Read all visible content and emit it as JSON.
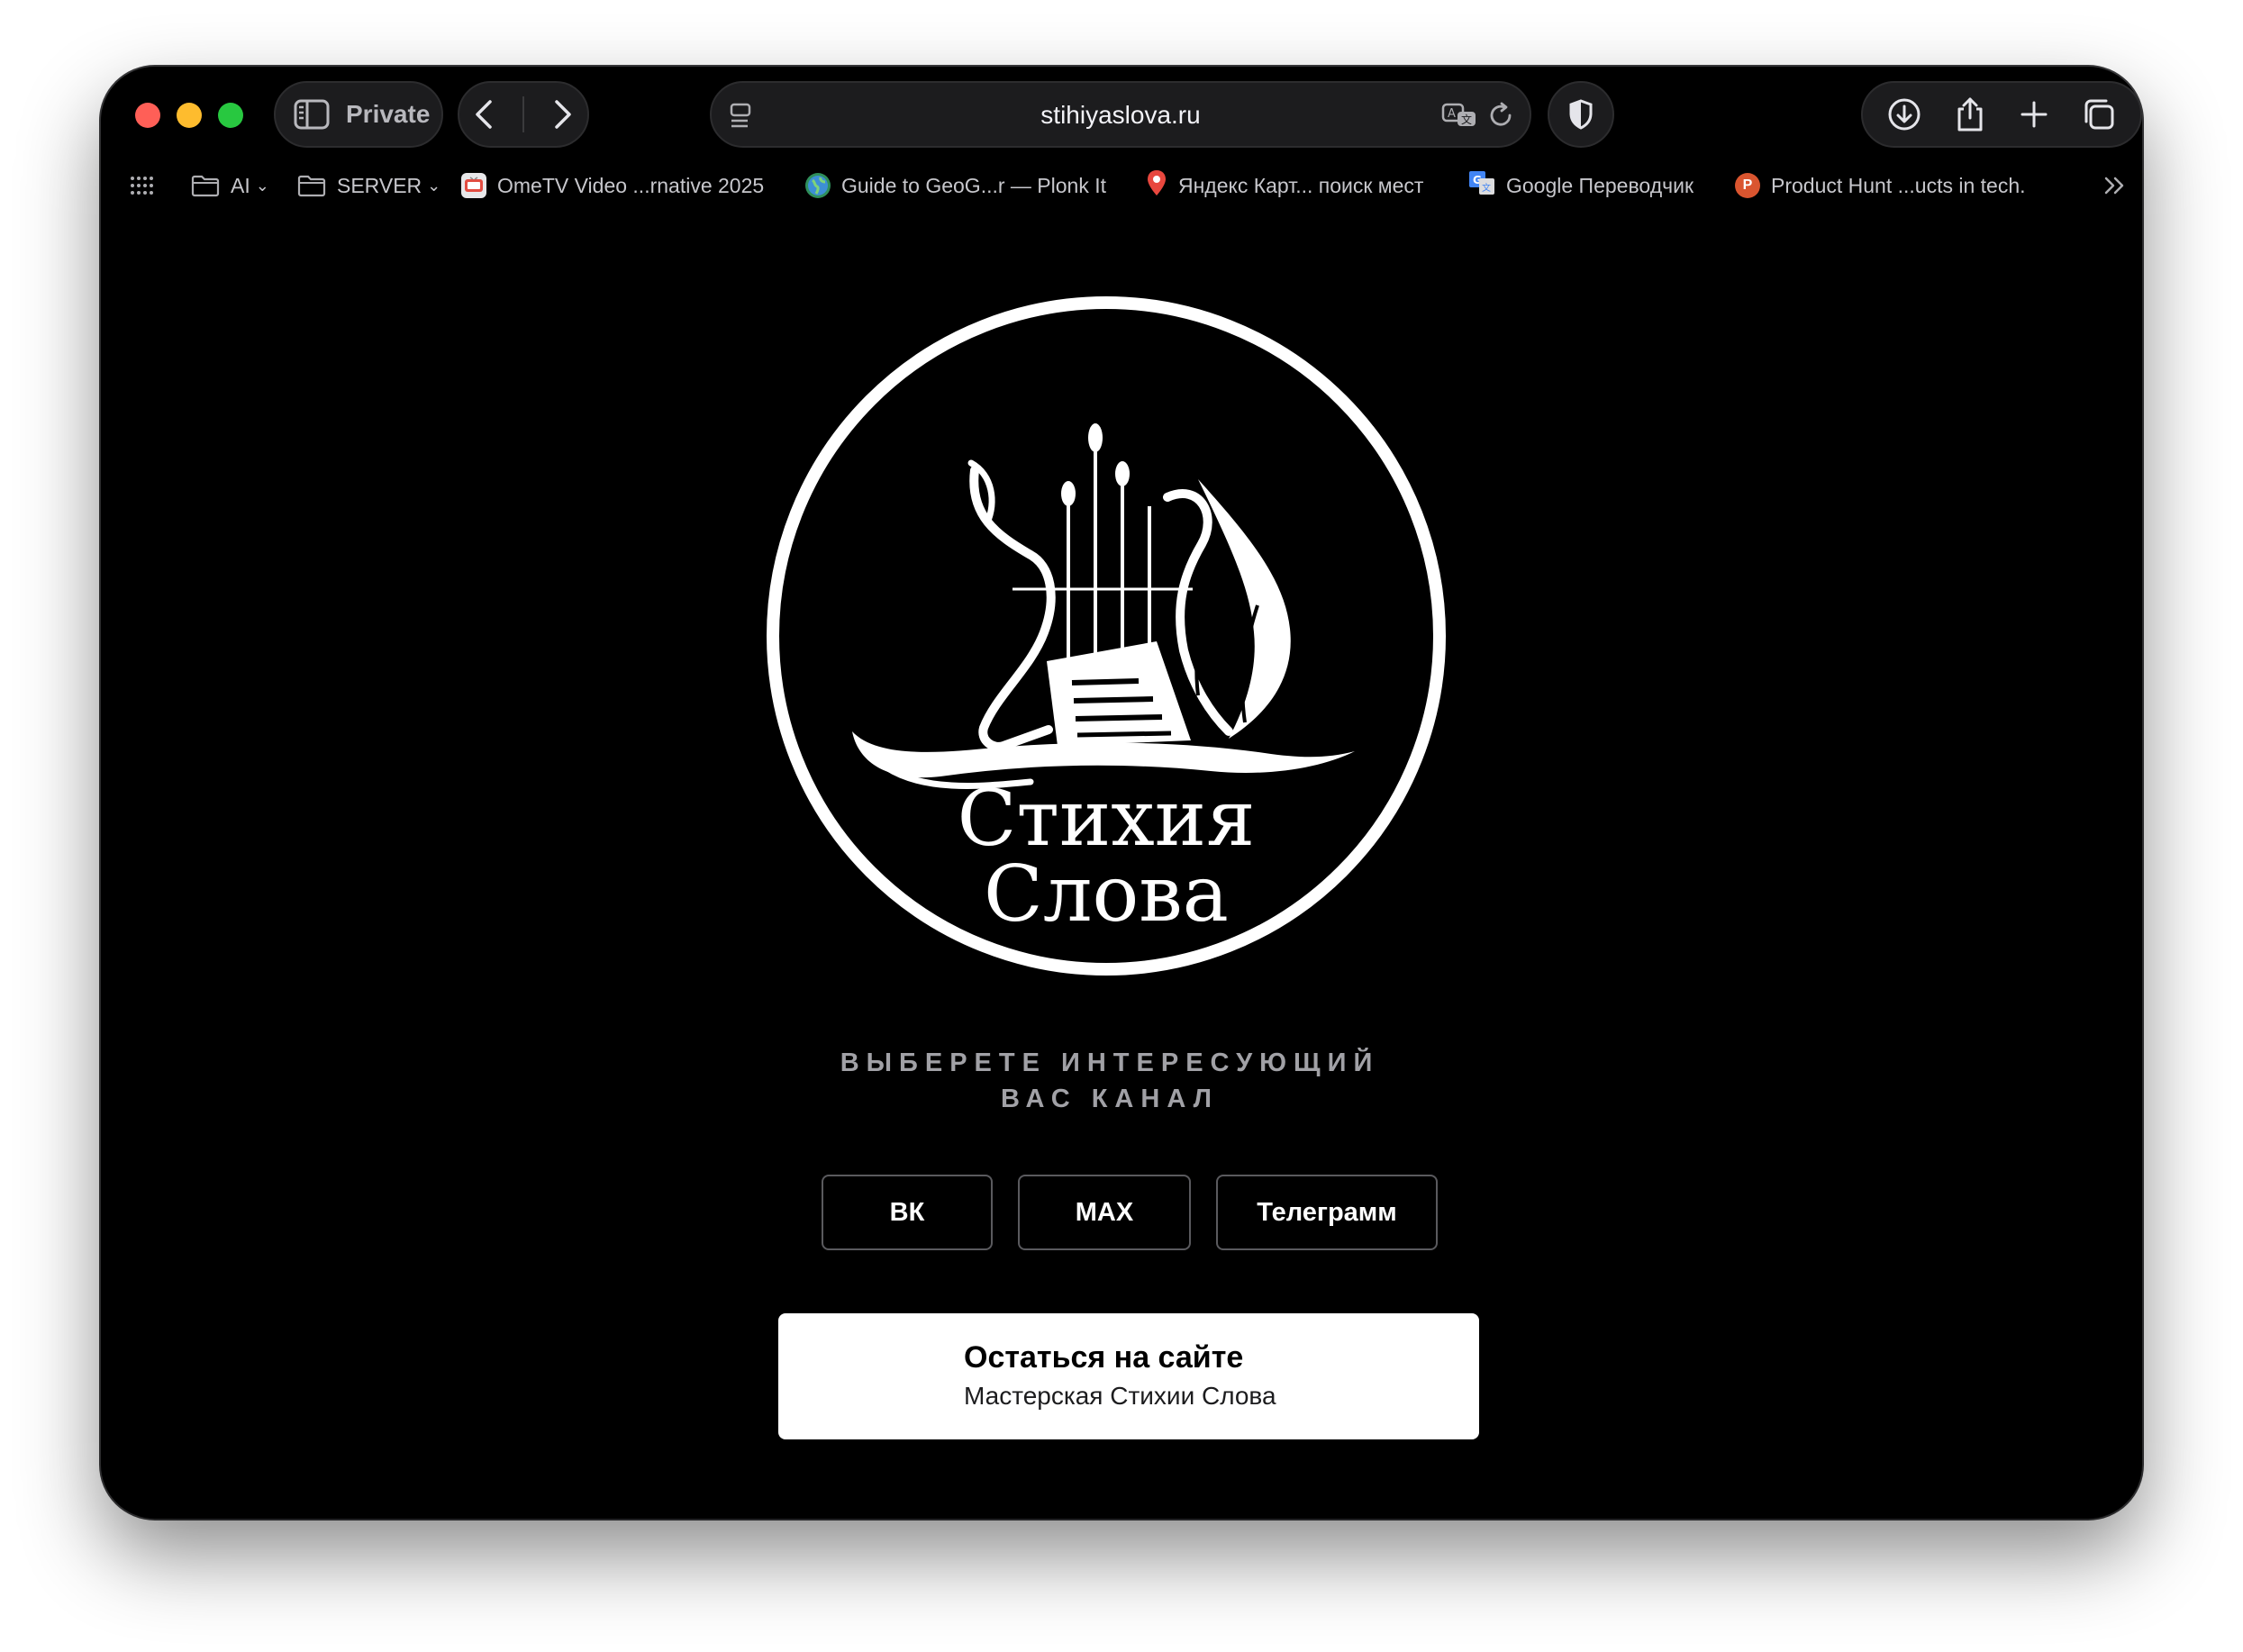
{
  "browser": {
    "private_label": "Private",
    "url": "stihiyaslova.ru"
  },
  "bookmarks": {
    "items": [
      {
        "label": "AI"
      },
      {
        "label": "SERVER"
      },
      {
        "label": "OmeTV Video ...rnative 2025"
      },
      {
        "label": "Guide to GeoG...r — Plonk It"
      },
      {
        "label": "Яндекс Карт... поиск мест"
      },
      {
        "label": "Google Переводчик"
      },
      {
        "label": "Product Hunt ...ucts in tech."
      }
    ]
  },
  "logo": {
    "line1": "Стихия",
    "line2": "Слова"
  },
  "main": {
    "heading": "ВЫБЕРЕТЕ ИНТЕРЕСУЮЩИЙ ВАС КАНАЛ",
    "channels": [
      "ВК",
      "MAX",
      "Телеграмм"
    ],
    "stay_title": "Остаться на сайте",
    "stay_subtitle": "Мастерская Стихии Слова"
  },
  "colors": {
    "page_bg": "#000000",
    "button_border": "#5a5a5e",
    "heading_text": "#a1a1a6"
  }
}
